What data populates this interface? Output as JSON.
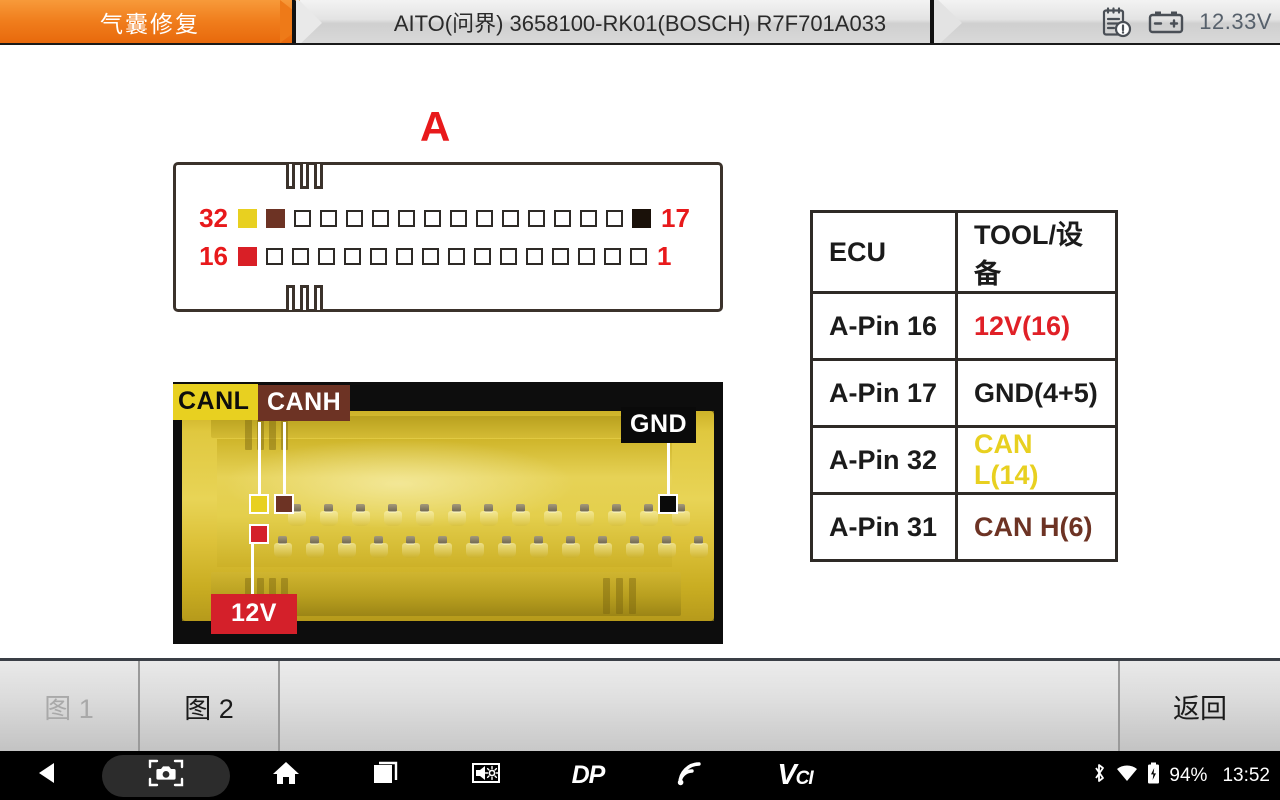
{
  "header": {
    "mode_label": "气囊修复",
    "vehicle_title": "AITO(问界) 3658100-RK01(BOSCH) R7F701A033",
    "report_icon": "clipboard-alert-icon",
    "battery_icon": "car-battery-icon",
    "voltage": "12.33V"
  },
  "diagram": {
    "connector_label": "A",
    "top_row": {
      "left_number": "32",
      "right_number": "17",
      "pins": [
        {
          "color": "#e8d020",
          "filled": true
        },
        {
          "color": "#6d3324",
          "filled": true
        },
        {
          "color": "",
          "filled": false
        },
        {
          "color": "",
          "filled": false
        },
        {
          "color": "",
          "filled": false
        },
        {
          "color": "",
          "filled": false
        },
        {
          "color": "",
          "filled": false
        },
        {
          "color": "",
          "filled": false
        },
        {
          "color": "",
          "filled": false
        },
        {
          "color": "",
          "filled": false
        },
        {
          "color": "",
          "filled": false
        },
        {
          "color": "",
          "filled": false
        },
        {
          "color": "",
          "filled": false
        },
        {
          "color": "",
          "filled": false
        },
        {
          "color": "",
          "filled": false
        },
        {
          "color": "#1a1109",
          "filled": true
        }
      ]
    },
    "bottom_row": {
      "left_number": "16",
      "right_number": "1",
      "pins": [
        {
          "color": "#d91f26",
          "filled": true
        },
        {
          "color": "",
          "filled": false
        },
        {
          "color": "",
          "filled": false
        },
        {
          "color": "",
          "filled": false
        },
        {
          "color": "",
          "filled": false
        },
        {
          "color": "",
          "filled": false
        },
        {
          "color": "",
          "filled": false
        },
        {
          "color": "",
          "filled": false
        },
        {
          "color": "",
          "filled": false
        },
        {
          "color": "",
          "filled": false
        },
        {
          "color": "",
          "filled": false
        },
        {
          "color": "",
          "filled": false
        },
        {
          "color": "",
          "filled": false
        },
        {
          "color": "",
          "filled": false
        },
        {
          "color": "",
          "filled": false
        },
        {
          "color": "",
          "filled": false
        }
      ]
    }
  },
  "photo": {
    "callouts": {
      "canl": "CANL",
      "canh": "CANH",
      "gnd": "GND",
      "v12": "12V"
    },
    "marker_colors": {
      "canl": "#e8d020",
      "canh": "#6d3324",
      "v12": "#d4202a",
      "gnd": "#0a0a0a"
    }
  },
  "table": {
    "headers": [
      "ECU",
      "TOOL/设备"
    ],
    "rows": [
      {
        "ecu": "A-Pin 16",
        "tool": "12V(16)",
        "tool_color": "#e02027"
      },
      {
        "ecu": "A-Pin 17",
        "tool": "GND(4+5)",
        "tool_color": "#1b1b1b"
      },
      {
        "ecu": "A-Pin 32",
        "tool": "CAN L(14)",
        "tool_color": "#e8d020"
      },
      {
        "ecu": "A-Pin 31",
        "tool": "CAN H(6)",
        "tool_color": "#6d3324"
      }
    ]
  },
  "toolbar": {
    "tab1_label": "图 1",
    "tab2_label": "图 2",
    "back_label": "返回"
  },
  "navbar": {
    "back_icon": "back-triangle-icon",
    "screenshot_icon": "camera-screenshot-icon",
    "home_icon": "home-icon",
    "recents_icon": "recent-apps-icon",
    "volume_icon": "volume-brightness-icon",
    "dp_logo": "DP",
    "signal_icon": "signal-waves-icon",
    "vci_logo_v": "V",
    "vci_logo_ci": "CI",
    "bluetooth_icon": "bluetooth-icon",
    "wifi_icon": "wifi-icon",
    "battery_icon": "battery-icon",
    "battery_percent": "94%",
    "clock": "13:52"
  }
}
